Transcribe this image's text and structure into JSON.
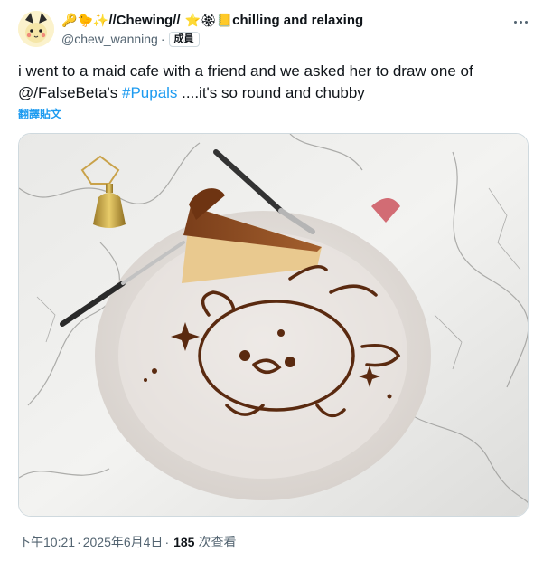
{
  "author": {
    "display_name": "//Chewing//",
    "status_text": "chilling and relaxing",
    "handle": "@chew_wanning",
    "badge": "成員",
    "separator": "·",
    "name_emoji_1": "🔑",
    "name_emoji_2": "🐤",
    "name_emoji_3": "✨",
    "status_emoji_1": "⭐",
    "status_emoji_2": "🏵",
    "status_emoji_3": "📒"
  },
  "post": {
    "text_before": "i went to a maid cafe with a friend and we asked her to draw one of @/FalseBeta's ",
    "hashtag": "#Pupals",
    "text_after": " ....it's so round and chubby",
    "translate_label": "翻譯貼文"
  },
  "meta": {
    "time": "下午10:21",
    "date": "2025年6月4日",
    "separator": "·",
    "views_count": "185",
    "views_label": "次查看"
  },
  "colors": {
    "link": "#1d9bf0",
    "secondary_text": "#536471",
    "primary_text": "#0f1419"
  },
  "icons": {
    "more": "more-options-icon"
  }
}
